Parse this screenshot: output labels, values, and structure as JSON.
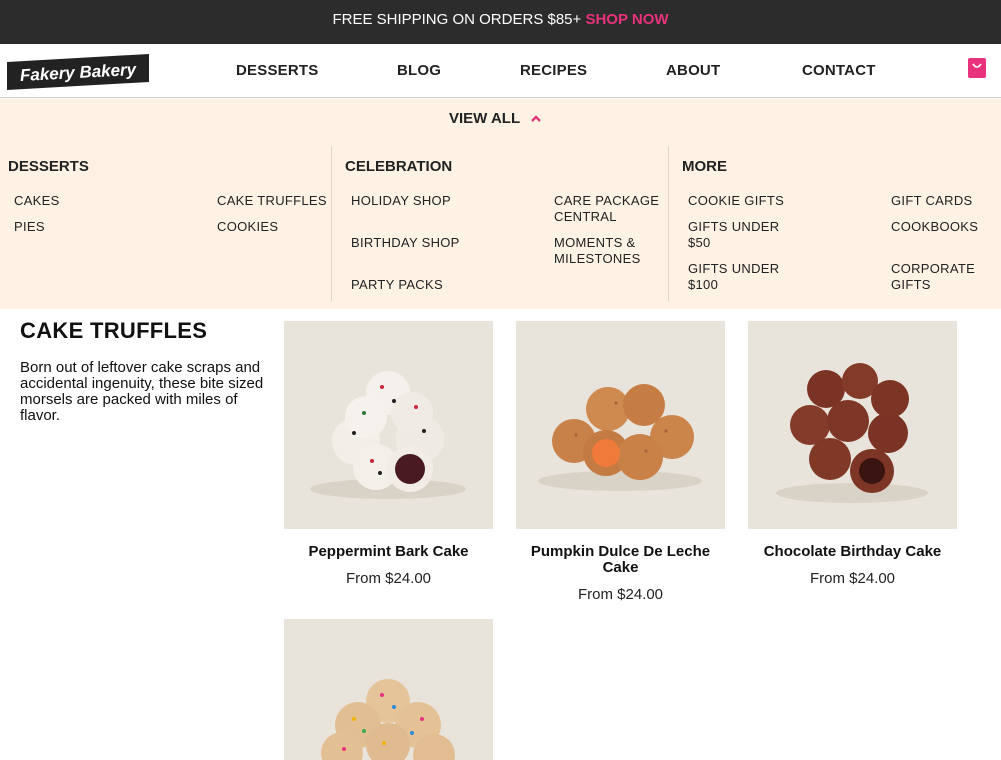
{
  "promo": {
    "text": "FREE SHIPPING ON ORDERS $85+",
    "cta": "SHOP NOW"
  },
  "header": {
    "logo_text": "Fakery Bakery",
    "nav": [
      "DESSERTS",
      "BLOG",
      "RECIPES",
      "ABOUT",
      "CONTACT"
    ],
    "cart_icon": "cart-icon"
  },
  "mega_menu": {
    "view_all": "VIEW ALL",
    "columns": [
      {
        "title": "DESSERTS",
        "links": [
          "CAKES",
          "CAKE TRUFFLES",
          "PIES",
          "COOKIES"
        ]
      },
      {
        "title": "CELEBRATION",
        "links": [
          "HOLIDAY SHOP",
          "CARE PACKAGE CENTRAL",
          "BIRTHDAY SHOP",
          "MOMENTS & MILESTONES",
          "PARTY PACKS"
        ]
      },
      {
        "title": "MORE",
        "links": [
          "COOKIE GIFTS",
          "GIFT CARDS",
          "GIFTS UNDER $50",
          "COOKBOOKS",
          "GIFTS UNDER $100",
          "CORPORATE GIFTS"
        ]
      }
    ]
  },
  "category": {
    "title": "CAKE TRUFFLES",
    "description": "Born out of leftover cake scraps and accidental ingenuity, these bite sized morsels are packed with miles of flavor."
  },
  "products": [
    {
      "name": "Peppermint Bark Cake",
      "price": "From $24.00"
    },
    {
      "name": "Pumpkin Dulce De Leche Cake",
      "price": "From $24.00"
    },
    {
      "name": "Chocolate Birthday Cake",
      "price": "From $24.00"
    }
  ],
  "colors": {
    "accent": "#e8327c",
    "promo_bg": "#2c2c2c",
    "menu_bg": "#fdf2e4"
  }
}
